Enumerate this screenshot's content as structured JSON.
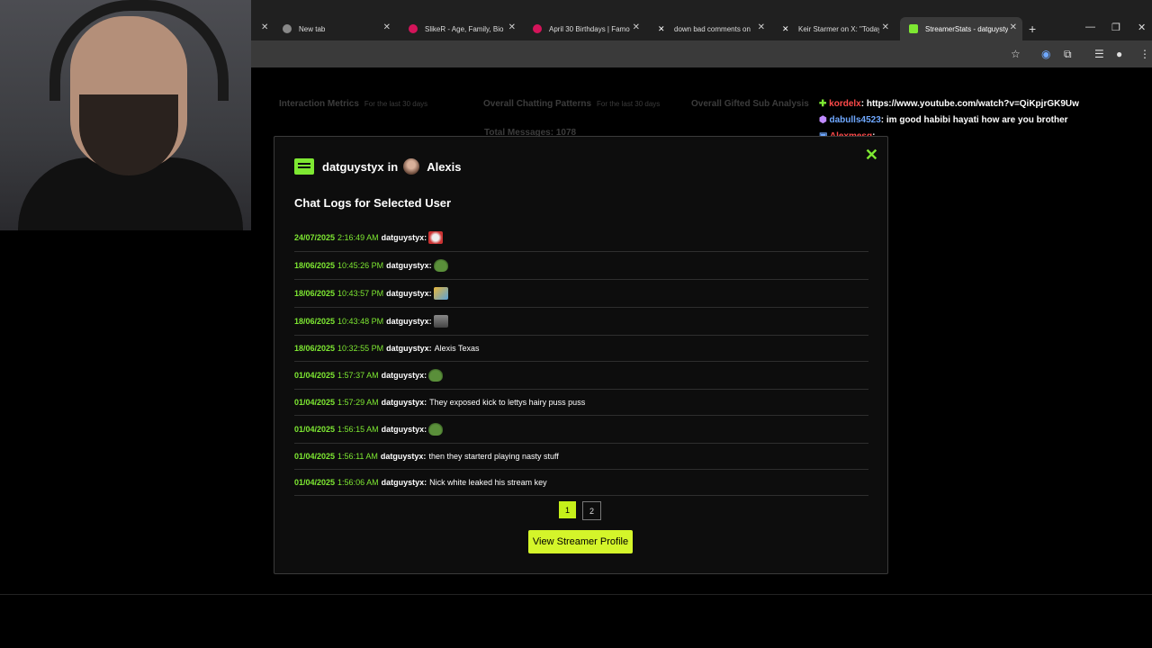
{
  "browser": {
    "tabs": [
      {
        "title": "New tab",
        "color": "#888888"
      },
      {
        "title": "SlikeR - Age, Family, Bio |",
        "color": "#d4145a"
      },
      {
        "title": "April 30 Birthdays | Famo",
        "color": "#d4145a"
      },
      {
        "title": "down bad comments on",
        "color": "#ffffff"
      },
      {
        "title": "Keir Starmer on X: \"Today",
        "color": "#ffffff"
      },
      {
        "title": "StreamerStats - datguysty",
        "color": "#7ee832"
      }
    ],
    "new_tab_glyph": "+",
    "close_glyph": "✕"
  },
  "background": {
    "panel1": {
      "title": "Interaction Metrics",
      "sub": "For the last 30 days"
    },
    "panel2": {
      "title": "Overall Chatting Patterns",
      "sub": "For the last 30 days"
    },
    "panel3": {
      "title": "Overall Gifted Sub Analysis"
    },
    "total_messages": "Total Messages: 1078"
  },
  "chat_overlay": [
    {
      "user": "kordelx",
      "text": ": https://www.youtube.com/watch?v=QiKpjrGK9Uw",
      "color": "#ff4a4a"
    },
    {
      "user": "dabulls4523",
      "text": ": im good habibi hayati how are you brother",
      "color": "#6fa8ff"
    },
    {
      "user": "Alexmesq",
      "text": ":",
      "color": "#ff4a4a"
    }
  ],
  "modal": {
    "username": "datguystyx",
    "in_word": "in",
    "streamer": "Alexis",
    "subtitle": "Chat Logs for Selected User",
    "close_glyph": "✕",
    "logs": [
      {
        "date": "24/07/2025",
        "time": "2:16:49 AM",
        "user": "datguystyx:",
        "msg": "",
        "emote": "e1"
      },
      {
        "date": "18/06/2025",
        "time": "10:45:26 PM",
        "user": "datguystyx:",
        "msg": "",
        "emote": "frog"
      },
      {
        "date": "18/06/2025",
        "time": "10:43:57 PM",
        "user": "datguystyx:",
        "msg": "",
        "emote": "e3"
      },
      {
        "date": "18/06/2025",
        "time": "10:43:48 PM",
        "user": "datguystyx:",
        "msg": "",
        "emote": "e4"
      },
      {
        "date": "18/06/2025",
        "time": "10:32:55 PM",
        "user": "datguystyx:",
        "msg": "Alexis Texas",
        "emote": ""
      },
      {
        "date": "01/04/2025",
        "time": "1:57:37 AM",
        "user": "datguystyx:",
        "msg": "",
        "emote": "frog"
      },
      {
        "date": "01/04/2025",
        "time": "1:57:29 AM",
        "user": "datguystyx:",
        "msg": "They exposed kick to lettys hairy puss puss",
        "emote": ""
      },
      {
        "date": "01/04/2025",
        "time": "1:56:15 AM",
        "user": "datguystyx:",
        "msg": "",
        "emote": "frog"
      },
      {
        "date": "01/04/2025",
        "time": "1:56:11 AM",
        "user": "datguystyx:",
        "msg": "then they starterd playing nasty stuff",
        "emote": ""
      },
      {
        "date": "01/04/2025",
        "time": "1:56:06 AM",
        "user": "datguystyx:",
        "msg": "Nick white leaked his stream key",
        "emote": ""
      }
    ],
    "pages": [
      "1",
      "2"
    ],
    "current_page": "1",
    "profile_button": "View Streamer Profile"
  },
  "colors": {
    "accent": "#7ee832",
    "button": "#d4f52a"
  }
}
